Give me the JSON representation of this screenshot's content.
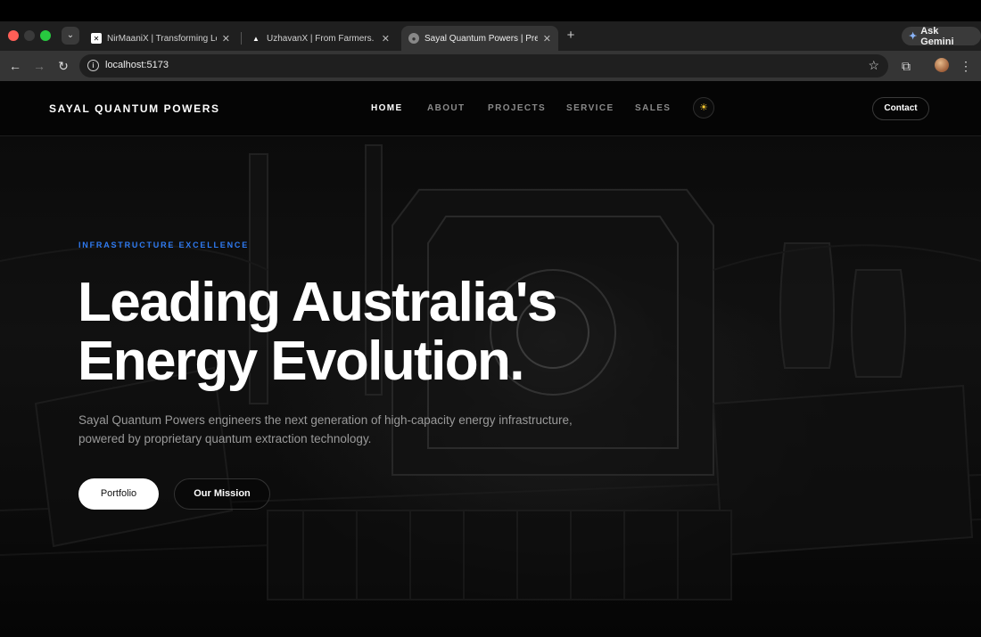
{
  "browser": {
    "tabs": [
      {
        "title": "NirMaaniX | Transforming Loc",
        "favicon": "x-square-icon"
      },
      {
        "title": "UzhavanX | From Farmers. Fo",
        "favicon": "triangle-icon"
      },
      {
        "title": "Sayal Quantum Powers | Pren",
        "favicon": "globe-icon",
        "active": true
      }
    ],
    "new_tab": "+",
    "gemini_label": "Ask Gemini",
    "url": "localhost:5173"
  },
  "site": {
    "logo": "SAYAL QUANTUM POWERS",
    "nav": [
      {
        "label": "HOME",
        "active": true
      },
      {
        "label": "ABOUT"
      },
      {
        "label": "PROJECTS"
      },
      {
        "label": "SERVICE"
      },
      {
        "label": "SALES"
      }
    ],
    "theme_toggle_icon": "sun-icon",
    "contact_label": "Contact",
    "hero": {
      "eyebrow": "INFRASTRUCTURE EXCELLENCE",
      "headline_line1": "Leading Australia's",
      "headline_line2": "Energy Evolution.",
      "subtext": "Sayal Quantum Powers engineers the next generation of high-capacity energy infrastructure, powered by proprietary quantum extraction technology.",
      "primary_button": "Portfolio",
      "secondary_button": "Our Mission"
    }
  },
  "colors": {
    "accent_blue": "#2f7bf2",
    "background": "#050505",
    "sun_icon": "#ffcf33"
  }
}
